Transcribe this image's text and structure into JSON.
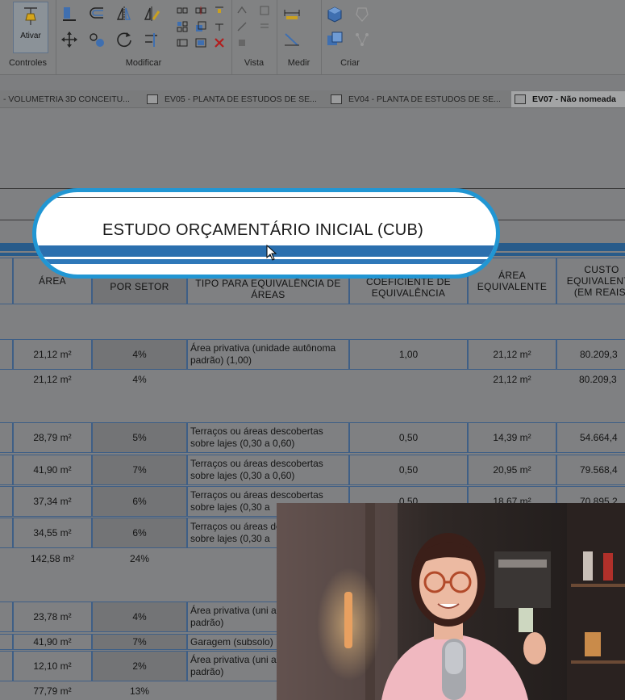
{
  "ribbon": {
    "panels": [
      {
        "label": "Controles"
      },
      {
        "label": "Modificar"
      },
      {
        "label": "Vista"
      },
      {
        "label": "Medir"
      },
      {
        "label": "Criar"
      }
    ],
    "ativar_label": "Ativar"
  },
  "tabs": [
    {
      "label": "- VOLUMETRIA 3D CONCEITU..."
    },
    {
      "label": "EV05 - PLANTA DE ESTUDOS DE SE..."
    },
    {
      "label": "EV04 - PLANTA DE ESTUDOS DE SE..."
    },
    {
      "label": "EV07 - Não nomeada"
    }
  ],
  "schedule": {
    "title": "ESTUDO ORÇAMENTÁRIO INICIAL (CUB)",
    "headers": {
      "area": "ÁREA",
      "porcentagem": "PORCENTAGEM POR SETOR",
      "tipo": "TIPO PARA EQUIVALÊNCIA DE ÁREAS",
      "coeficiente": "COEFICIENTE DE EQUIVALÊNCIA",
      "area_equiv": "ÁREA EQUIVALENTE",
      "custo": "CUSTO EQUIVALENTE (EM REAIS)"
    },
    "rows": [
      {
        "area": "21,12 m²",
        "pct": "4%",
        "tipo": "Área privativa (unidade autônoma padrão) (1,00)",
        "coef": "1,00",
        "aeq": "21,12 m²",
        "custo": "80.209,3"
      },
      {
        "area": "21,12 m²",
        "pct": "4%",
        "tipo": "",
        "coef": "",
        "aeq": "21,12 m²",
        "custo": "80.209,3"
      },
      {
        "area": "28,79 m²",
        "pct": "5%",
        "tipo": "Terraços ou áreas descobertas sobre lajes (0,30 a 0,60)",
        "coef": "0,50",
        "aeq": "14,39 m²",
        "custo": "54.664,4"
      },
      {
        "area": "41,90 m²",
        "pct": "7%",
        "tipo": "Terraços ou áreas descobertas sobre lajes (0,30 a 0,60)",
        "coef": "0,50",
        "aeq": "20,95 m²",
        "custo": "79.568,4"
      },
      {
        "area": "37,34 m²",
        "pct": "6%",
        "tipo": "Terraços ou áreas descobertas sobre lajes (0,30 a",
        "coef": "0,50",
        "aeq": "18,67 m²",
        "custo": "70.895,2"
      },
      {
        "area": "34,55 m²",
        "pct": "6%",
        "tipo": "Terraços ou áreas descobertas sobre lajes (0,30 a",
        "coef": "",
        "aeq": "",
        "custo": ""
      },
      {
        "area": "142,58 m²",
        "pct": "24%",
        "tipo": "",
        "coef": "",
        "aeq": "",
        "custo": ""
      },
      {
        "area": "23,78 m²",
        "pct": "4%",
        "tipo": "Área privativa (uni autônoma padrão)",
        "coef": "",
        "aeq": "",
        "custo": ""
      },
      {
        "area": "41,90 m²",
        "pct": "7%",
        "tipo": "Garagem (subsolo)",
        "coef": "",
        "aeq": "",
        "custo": ""
      },
      {
        "area": "12,10 m²",
        "pct": "2%",
        "tipo": "Área privativa (uni autônoma padrão)",
        "coef": "",
        "aeq": "",
        "custo": ""
      },
      {
        "area": "77,79 m²",
        "pct": "13%",
        "tipo": "",
        "coef": "",
        "aeq": "",
        "custo": ""
      }
    ]
  }
}
